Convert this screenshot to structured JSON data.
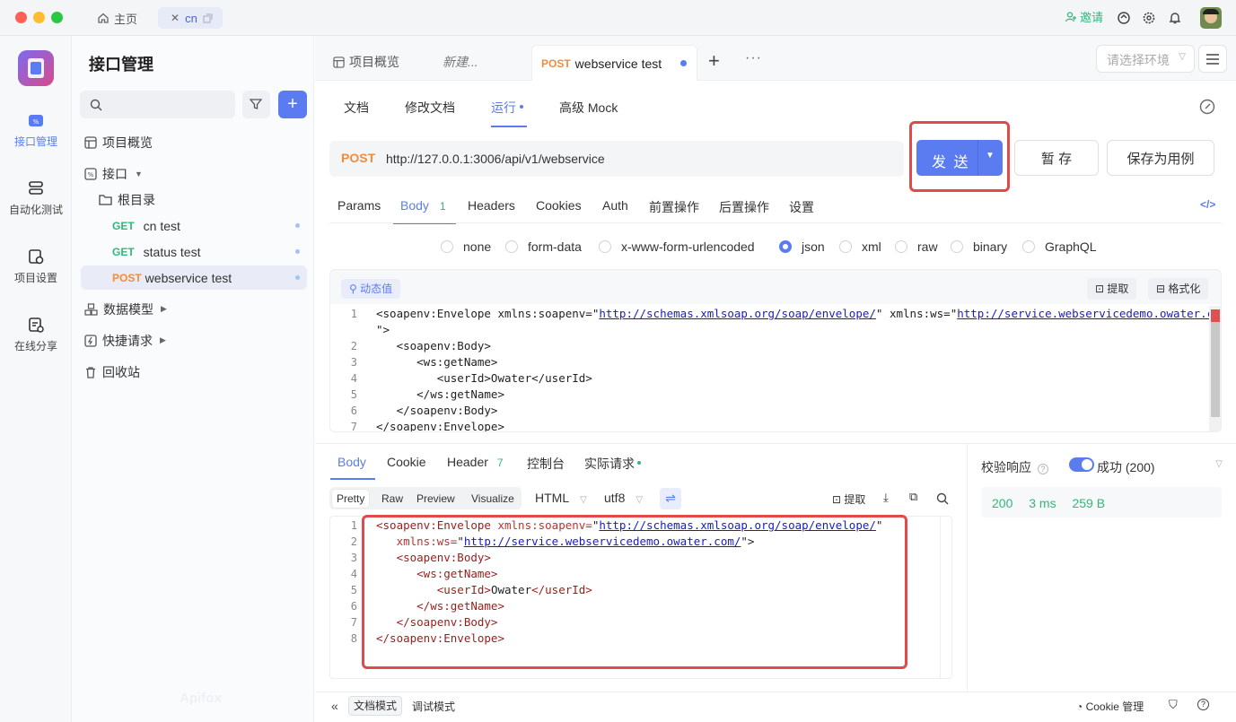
{
  "topbar": {
    "home_label": "主页",
    "tab_label": "cn",
    "invite_label": "邀请"
  },
  "rail": {
    "items": [
      {
        "label": "接口管理"
      },
      {
        "label": "自动化测试"
      },
      {
        "label": "项目设置"
      },
      {
        "label": "在线分享"
      }
    ]
  },
  "sidebar": {
    "title": "接口管理",
    "search_placeholder": "",
    "overview": "项目概览",
    "api_group": "接口",
    "root_folder": "根目录",
    "apis": [
      {
        "method": "GET",
        "name": "cn test"
      },
      {
        "method": "GET",
        "name": "status test"
      },
      {
        "method": "POST",
        "name": "webservice test"
      }
    ],
    "data_model": "数据模型",
    "quick_request": "快捷请求",
    "recycle_bin": "回收站",
    "watermark": "Apifox"
  },
  "doc_tabs": {
    "overview": "项目概览",
    "new": "新建...",
    "active_method": "POST",
    "active_name": "webservice test",
    "env_placeholder": "请选择环境"
  },
  "sub_tabs": [
    "文档",
    "修改文档",
    "运行",
    "高级 Mock"
  ],
  "request": {
    "method": "POST",
    "url": "http://127.0.0.1:3006/api/v1/webservice",
    "send": "发 送",
    "save": "暂 存",
    "save_case": "保存为用例"
  },
  "param_tabs": [
    "Params",
    "Body",
    "Headers",
    "Cookies",
    "Auth",
    "前置操作",
    "后置操作",
    "设置"
  ],
  "body_count": "1",
  "body_types": [
    "none",
    "form-data",
    "x-www-form-urlencoded",
    "json",
    "xml",
    "raw",
    "binary",
    "GraphQL"
  ],
  "selected_body_type": "json",
  "editor": {
    "dynamic_value": "动态值",
    "extract": "提取",
    "format": "格式化"
  },
  "request_code": [
    {
      "n": "1",
      "parts": [
        [
          "tag",
          "<soapenv:Envelope xmlns:soapenv=\""
        ],
        [
          "url",
          "http://schemas.xmlsoap.org/soap/envelope/"
        ],
        [
          "tag",
          "\" xmlns:ws=\""
        ],
        [
          "url",
          "http://service.webservicedemo.owater.com/"
        ]
      ]
    },
    {
      "n": "",
      "parts": [
        [
          "tag",
          "\">"
        ]
      ]
    },
    {
      "n": "2",
      "parts": [
        [
          "tag",
          "   <soapenv:Body>"
        ]
      ]
    },
    {
      "n": "3",
      "parts": [
        [
          "tag",
          "      <ws:getName>"
        ]
      ]
    },
    {
      "n": "4",
      "parts": [
        [
          "tag",
          "         <userId>Owater</userId>"
        ]
      ]
    },
    {
      "n": "5",
      "parts": [
        [
          "tag",
          "      </ws:getName>"
        ]
      ]
    },
    {
      "n": "6",
      "parts": [
        [
          "tag",
          "   </soapenv:Body>"
        ]
      ]
    },
    {
      "n": "7",
      "parts": [
        [
          "tag",
          "</soapenv:Envelope>"
        ]
      ]
    }
  ],
  "response": {
    "tabs": [
      "Body",
      "Cookie",
      "Header",
      "控制台",
      "实际请求"
    ],
    "header_count": "7",
    "view_modes": [
      "Pretty",
      "Raw",
      "Preview",
      "Visualize"
    ],
    "format": "HTML",
    "encoding": "utf8",
    "extract": "提取",
    "validate_label": "校验响应",
    "status_label": "成功 (200)",
    "status_code": "200",
    "time": "3 ms",
    "size": "259 B"
  },
  "response_code": [
    {
      "n": "1",
      "parts": [
        [
          "rtag",
          "<soapenv:Envelope "
        ],
        [
          "attr",
          "xmlns:soapenv="
        ],
        [
          "tag",
          "\""
        ],
        [
          "url",
          "http://schemas.xmlsoap.org/soap/envelope/"
        ],
        [
          "tag",
          "\""
        ]
      ]
    },
    {
      "n": "2",
      "parts": [
        [
          "attr",
          "   xmlns:ws="
        ],
        [
          "tag",
          "\""
        ],
        [
          "url",
          "http://service.webservicedemo.owater.com/"
        ],
        [
          "tag",
          "\">"
        ]
      ]
    },
    {
      "n": "3",
      "parts": [
        [
          "rtag",
          "   <soapenv:Body>"
        ]
      ]
    },
    {
      "n": "4",
      "parts": [
        [
          "rtag",
          "      <ws:getName>"
        ]
      ]
    },
    {
      "n": "5",
      "parts": [
        [
          "rtag",
          "         <userId>"
        ],
        [
          "tag",
          "Owater"
        ],
        [
          "rtag",
          "</userId>"
        ]
      ]
    },
    {
      "n": "6",
      "parts": [
        [
          "rtag",
          "      </ws:getName>"
        ]
      ]
    },
    {
      "n": "7",
      "parts": [
        [
          "rtag",
          "   </soapenv:Body>"
        ]
      ]
    },
    {
      "n": "8",
      "parts": [
        [
          "rtag",
          "</soapenv:Envelope>"
        ]
      ]
    }
  ],
  "footer": {
    "doc_mode": "文档模式",
    "debug_mode": "调试模式",
    "cookie_manage": "Cookie 管理"
  },
  "colors": {
    "accent": "#5b7cf0",
    "get": "#2fb87a",
    "post": "#f08c3c",
    "highlight_box": "#e04a4a"
  }
}
